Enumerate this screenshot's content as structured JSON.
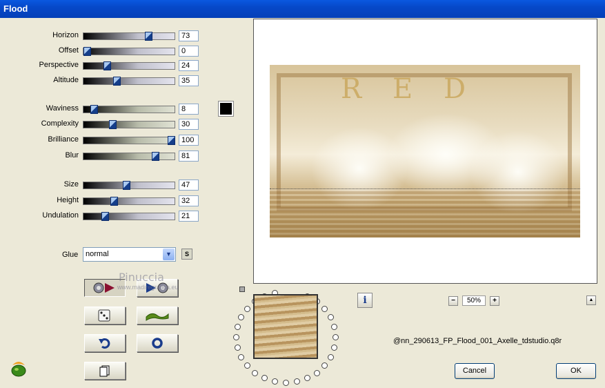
{
  "window": {
    "title": "Flood"
  },
  "sliders": [
    {
      "label": "Horizon",
      "value": 73,
      "display": "73"
    },
    {
      "label": "Offset",
      "value": 0,
      "display": "0"
    },
    {
      "label": "Perspective",
      "value": 24,
      "display": "24"
    },
    {
      "label": "Altitude",
      "value": 35,
      "display": "35"
    },
    {
      "label": "Waviness",
      "value": 8,
      "display": "8"
    },
    {
      "label": "Complexity",
      "value": 30,
      "display": "30"
    },
    {
      "label": "Brilliance",
      "value": 100,
      "display": "100"
    },
    {
      "label": "Blur",
      "value": 81,
      "display": "81"
    },
    {
      "label": "Size",
      "value": 47,
      "display": "47"
    },
    {
      "label": "Height",
      "value": 32,
      "display": "32"
    },
    {
      "label": "Undulation",
      "value": 21,
      "display": "21"
    }
  ],
  "color": {
    "swatch": "#000000"
  },
  "glue": {
    "label": "Glue",
    "value": "normal",
    "s_button": "S"
  },
  "watermark": {
    "text": "Pinuccia",
    "url": "www.madiregrafica.eu"
  },
  "preview": {
    "letters": [
      "R",
      "E",
      "D"
    ],
    "zoom": "50%",
    "zoom_minus": "−",
    "zoom_plus": "+",
    "scroll_up": "▲"
  },
  "info_label": "i",
  "filename": "@nn_290613_FP_Flood_001_Axelle_tdstudio.q8r",
  "buttons": {
    "cancel": "Cancel",
    "ok": "OK"
  },
  "icons": [
    "reset-icon",
    "randomize-icon",
    "dice-icon",
    "wave-icon",
    "undo-icon",
    "ring-icon",
    "copy-icon",
    "info-icon",
    "app-logo-icon"
  ]
}
